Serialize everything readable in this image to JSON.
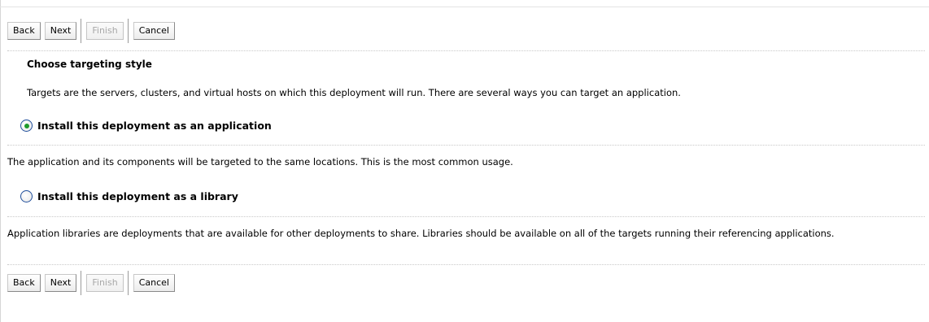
{
  "buttons": {
    "back": "Back",
    "next": "Next",
    "finish": "Finish",
    "cancel": "Cancel"
  },
  "section": {
    "title": "Choose targeting style",
    "description": "Targets are the servers, clusters, and virtual hosts on which this deployment will run. There are several ways you can target an application."
  },
  "options": [
    {
      "label": "Install this deployment as an application",
      "selected": true,
      "note": "The application and its components will be targeted to the same locations. This is the most common usage."
    },
    {
      "label": "Install this deployment as a library",
      "selected": false,
      "note": "Application libraries are deployments that are available for other deployments to share. Libraries should be available on all of the targets running their referencing applications."
    }
  ],
  "colors": {
    "radio_selected_dot": "#1e9a2a",
    "radio_border": "#1f4e9b",
    "disabled_text": "#a8a8a8"
  }
}
